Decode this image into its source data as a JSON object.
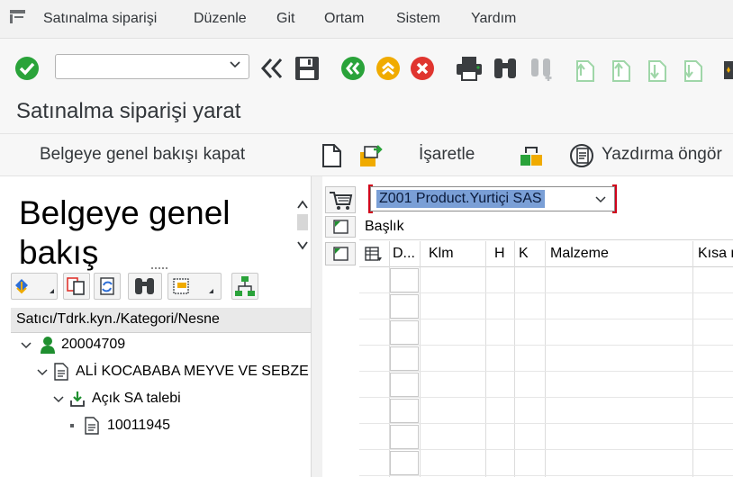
{
  "menu": {
    "items": [
      "Satınalma siparişi",
      "Düzenle",
      "Git",
      "Ortam",
      "Sistem",
      "Yardım"
    ]
  },
  "toolbar": {
    "command_field_value": ""
  },
  "page": {
    "title": "Satınalma siparişi yarat"
  },
  "app_toolbar": {
    "close_overview_label": "Belgeye genel bakışı kapat",
    "mark_label": "İşaretle",
    "print_preview_label": "Yazdırma öngör"
  },
  "overview": {
    "title": "Belgeye genel bakış"
  },
  "tree": {
    "header": "Satıcı/Tdrk.kyn./Kategori/Nesne",
    "rows": [
      {
        "label": "20004709"
      },
      {
        "label": "ALİ KOCABABA MEYVE VE SEBZE"
      },
      {
        "label": "Açık SA talebi"
      },
      {
        "label": "10011945"
      }
    ]
  },
  "po": {
    "type_value": "Z001 Product.Yurtiçi SAS",
    "header_label": "Başlık"
  },
  "grid": {
    "columns": [
      "D...",
      "Klm",
      "H",
      "K",
      "Malzeme",
      "Kısa metin"
    ]
  },
  "colors": {
    "accent_green": "#2aa33a",
    "accent_orange": "#f0ab00",
    "accent_red": "#e0352f",
    "selection": "#7a9fd6"
  }
}
